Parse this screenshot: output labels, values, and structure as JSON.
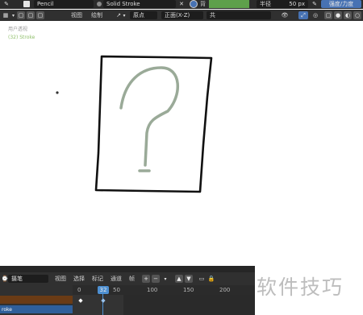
{
  "header": {
    "brush_name": "Pencil",
    "material_name": "Solid Stroke",
    "radius_label": "半径",
    "radius_value": "50 px",
    "strength_label": "强度/力度",
    "glyph_short": "背"
  },
  "toolbar2": {
    "view": "视图",
    "draw": "绘制",
    "origin": "原点",
    "orientation": "正面(X-Z)",
    "glyph_a": "共"
  },
  "overlay": {
    "view_name": "用户透视",
    "object_name": "(32) Stroke"
  },
  "timeline": {
    "mode": "摄笔",
    "menu": [
      "视图",
      "选择",
      "标记",
      "通道",
      "帧"
    ],
    "frame_current": "32",
    "ruler_labels": [
      "0",
      "50",
      "100",
      "150",
      "200"
    ],
    "channel_label": "roke"
  },
  "watermark": "软件技巧",
  "colors": {
    "canvas_bg": "#ffffff",
    "ui_dark": "#2b2b2b",
    "accent_blue": "#4772b3",
    "active_green": "#5ea04b",
    "playhead": "#4d8fd1"
  }
}
